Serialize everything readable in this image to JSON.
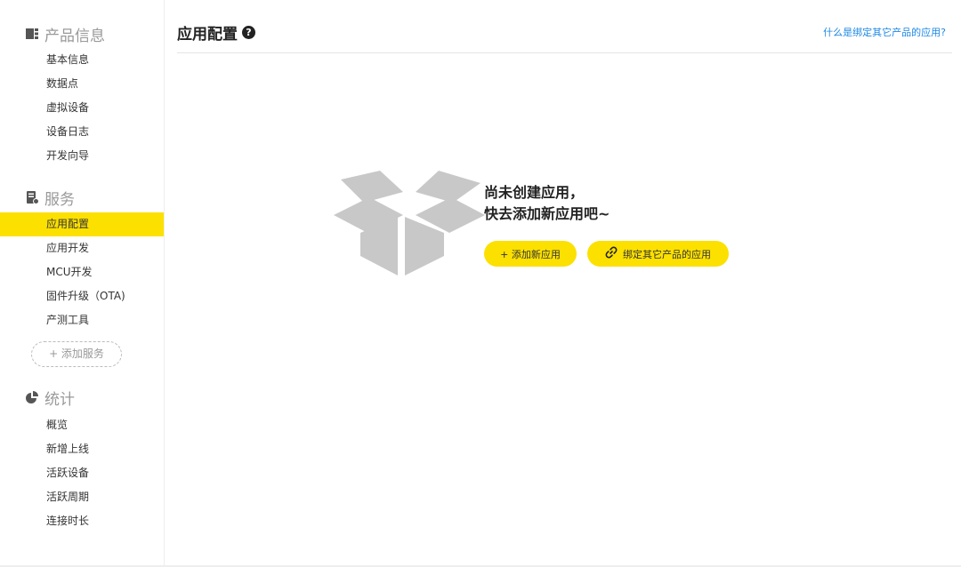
{
  "sidebar": {
    "product": {
      "title": "产品信息",
      "items": [
        "基本信息",
        "数据点",
        "虚拟设备",
        "设备日志",
        "开发向导"
      ]
    },
    "service": {
      "title": "服务",
      "items": [
        "应用配置",
        "应用开发",
        "MCU开发",
        "固件升级（OTA)",
        "产测工具"
      ],
      "active": "应用配置",
      "add_label": "+ 添加服务"
    },
    "stats": {
      "title": "统计",
      "items": [
        "概览",
        "新增上线",
        "活跃设备",
        "活跃周期",
        "连接时长"
      ]
    }
  },
  "main": {
    "title": "应用配置",
    "help_link": "什么是绑定其它产品的应用?",
    "empty_line1": "尚未创建应用，",
    "empty_line2": "快去添加新应用吧~",
    "add_button": "+ 添加新应用",
    "bind_button": "绑定其它产品的应用"
  },
  "colors": {
    "accent": "#fce000",
    "link": "#1e88e5",
    "box": "#c8c8c8"
  },
  "icons": {
    "product": "grid-icon",
    "service": "server-icon",
    "stats": "pie-chart-icon",
    "help": "question-circle-icon",
    "empty": "open-box-icon",
    "bind": "link-icon"
  }
}
